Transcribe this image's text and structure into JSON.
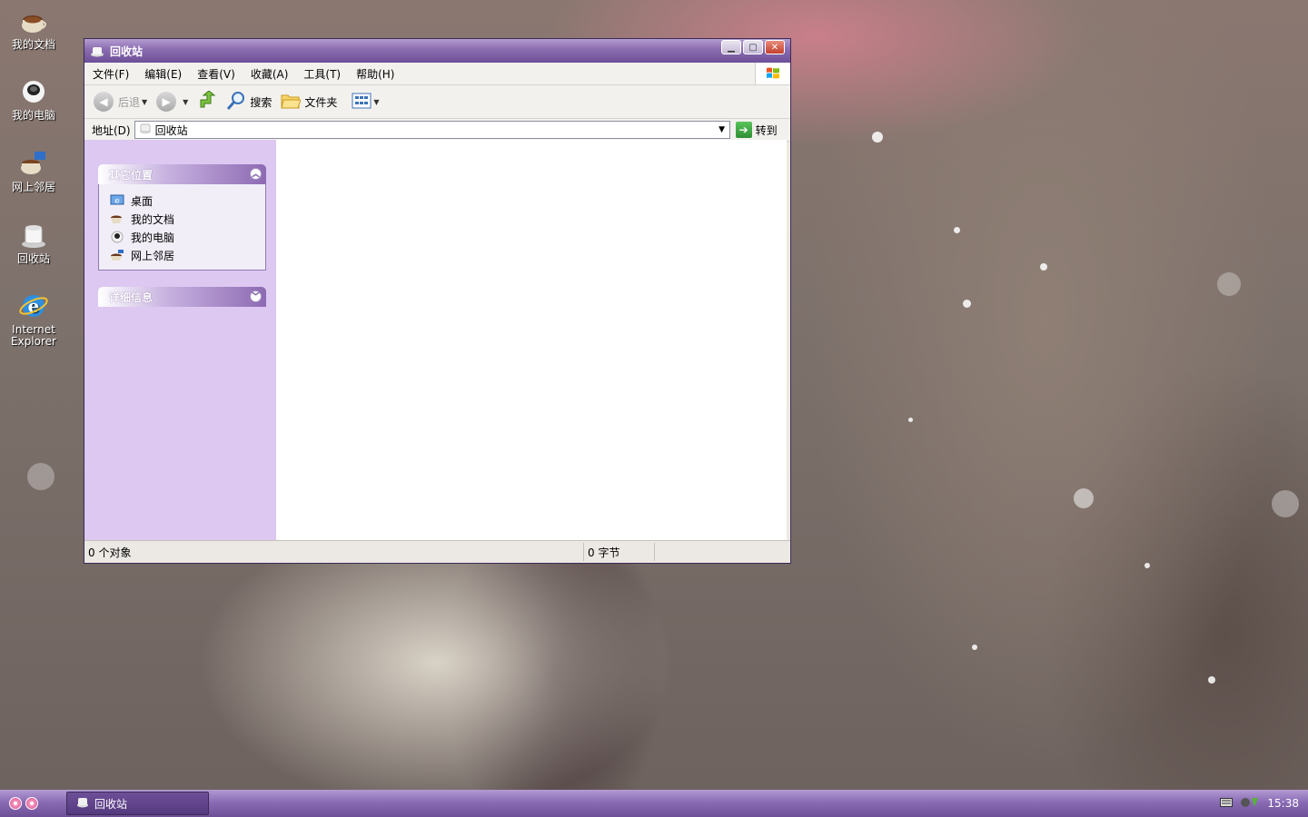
{
  "desktop": {
    "icons": [
      {
        "label": "我的文档"
      },
      {
        "label": "我的电脑"
      },
      {
        "label": "网上邻居"
      },
      {
        "label": "回收站"
      },
      {
        "label": "Internet Explorer"
      }
    ]
  },
  "window": {
    "title": "回收站",
    "menu": [
      "文件(F)",
      "编辑(E)",
      "查看(V)",
      "收藏(A)",
      "工具(T)",
      "帮助(H)"
    ],
    "toolbar": {
      "back": "后退",
      "search": "搜索",
      "folders": "文件夹"
    },
    "address": {
      "label": "地址(D)",
      "value": "回收站",
      "go": "转到"
    },
    "taskpane": {
      "other_places_title": "其它位置",
      "other_places": [
        "桌面",
        "我的文档",
        "我的电脑",
        "网上邻居"
      ],
      "details_title": "详细信息"
    },
    "status": {
      "objects": "0 个对象",
      "size": "0 字节"
    }
  },
  "taskbar": {
    "task_label": "回收站",
    "clock": "15:38"
  }
}
